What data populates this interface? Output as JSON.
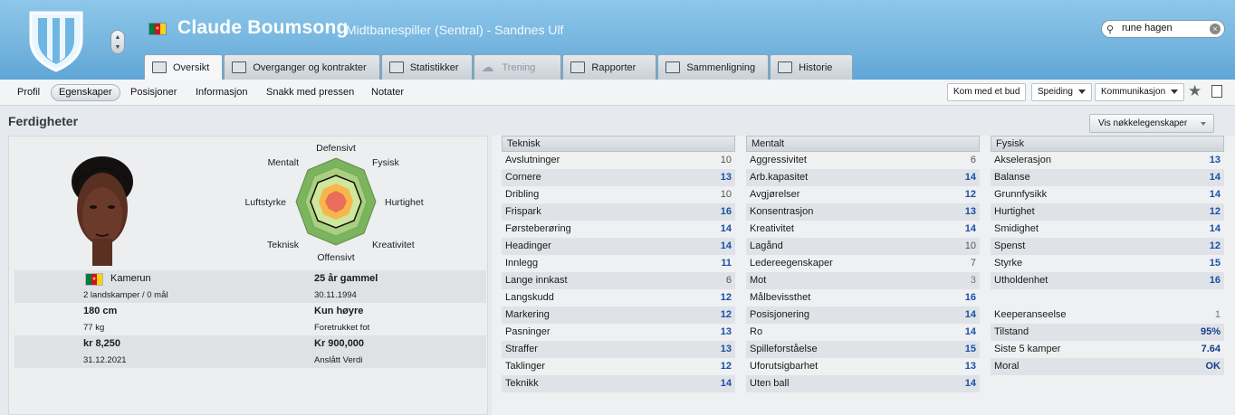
{
  "header": {
    "player_name": "Claude Boumsong",
    "player_role": "Midtbanespiller (Sentral) - Sandnes Ulf",
    "search_value": "rune hagen"
  },
  "tabs": [
    {
      "label": "Oversikt"
    },
    {
      "label": "Overganger og kontrakter"
    },
    {
      "label": "Statistikker"
    },
    {
      "label": "Trening"
    },
    {
      "label": "Rapporter"
    },
    {
      "label": "Sammenligning"
    },
    {
      "label": "Historie"
    }
  ],
  "subnav": {
    "items": [
      "Profil",
      "Egenskaper",
      "Posisjoner",
      "Informasjon",
      "Snakk med pressen",
      "Notater"
    ],
    "offer_button": "Kom med et bud",
    "scouting_button": "Speiding",
    "communication_button": "Kommunikasjon"
  },
  "section": {
    "title": "Ferdigheter",
    "key_attributes_button": "Vis nøkkelegenskaper"
  },
  "radar": {
    "labels": {
      "top": "Defensivt",
      "top_right": "Fysisk",
      "right": "Hurtighet",
      "bottom_right": "Kreativitet",
      "bottom": "Offensivt",
      "bottom_left": "Teknisk",
      "left": "Luftstyrke",
      "top_left": "Mentalt"
    }
  },
  "profile": {
    "nationality": "Kamerun",
    "caps": "2 landskamper / 0 mål",
    "age": "25 år gammel",
    "dob": "30.11.1994",
    "height": "180 cm",
    "weight": "77 kg",
    "foot": "Kun høyre",
    "foot_label": "Foretrukket fot",
    "wage": "kr 8,250",
    "contract_end": "31.12.2021",
    "value": "Kr 900,000",
    "value_label": "Anslått Verdi"
  },
  "technical": {
    "title": "Teknisk",
    "rows": [
      {
        "name": "Avslutninger",
        "value": "10"
      },
      {
        "name": "Cornere",
        "value": "13"
      },
      {
        "name": "Dribling",
        "value": "10"
      },
      {
        "name": "Frispark",
        "value": "16"
      },
      {
        "name": "Førsteberøring",
        "value": "14"
      },
      {
        "name": "Headinger",
        "value": "14"
      },
      {
        "name": "Innlegg",
        "value": "11"
      },
      {
        "name": "Lange innkast",
        "value": "6"
      },
      {
        "name": "Langskudd",
        "value": "12"
      },
      {
        "name": "Markering",
        "value": "12"
      },
      {
        "name": "Pasninger",
        "value": "13"
      },
      {
        "name": "Straffer",
        "value": "13"
      },
      {
        "name": "Taklinger",
        "value": "12"
      },
      {
        "name": "Teknikk",
        "value": "14"
      }
    ]
  },
  "mental": {
    "title": "Mentalt",
    "rows": [
      {
        "name": "Aggressivitet",
        "value": "6"
      },
      {
        "name": "Arb.kapasitet",
        "value": "14"
      },
      {
        "name": "Avgjørelser",
        "value": "12"
      },
      {
        "name": "Konsentrasjon",
        "value": "13"
      },
      {
        "name": "Kreativitet",
        "value": "14"
      },
      {
        "name": "Lagånd",
        "value": "10"
      },
      {
        "name": "Ledereegenskaper",
        "value": "7"
      },
      {
        "name": "Mot",
        "value": "3"
      },
      {
        "name": "Målbevissthet",
        "value": "16"
      },
      {
        "name": "Posisjonering",
        "value": "14"
      },
      {
        "name": "Ro",
        "value": "14"
      },
      {
        "name": "Spilleforståelse",
        "value": "15"
      },
      {
        "name": "Uforutsigbarhet",
        "value": "13"
      },
      {
        "name": "Uten ball",
        "value": "14"
      }
    ]
  },
  "physical": {
    "title": "Fysisk",
    "rows": [
      {
        "name": "Akselerasjon",
        "value": "13"
      },
      {
        "name": "Balanse",
        "value": "14"
      },
      {
        "name": "Grunnfysikk",
        "value": "14"
      },
      {
        "name": "Hurtighet",
        "value": "12"
      },
      {
        "name": "Smidighet",
        "value": "14"
      },
      {
        "name": "Spenst",
        "value": "12"
      },
      {
        "name": "Styrke",
        "value": "15"
      },
      {
        "name": "Utholdenhet",
        "value": "16"
      }
    ],
    "extra": [
      {
        "name": "Keeperanseelse",
        "value": "1"
      },
      {
        "name": "Tilstand",
        "value": "95%"
      },
      {
        "name": "Siste 5 kamper",
        "value": "7.64"
      },
      {
        "name": "Moral",
        "value": "OK"
      }
    ]
  }
}
